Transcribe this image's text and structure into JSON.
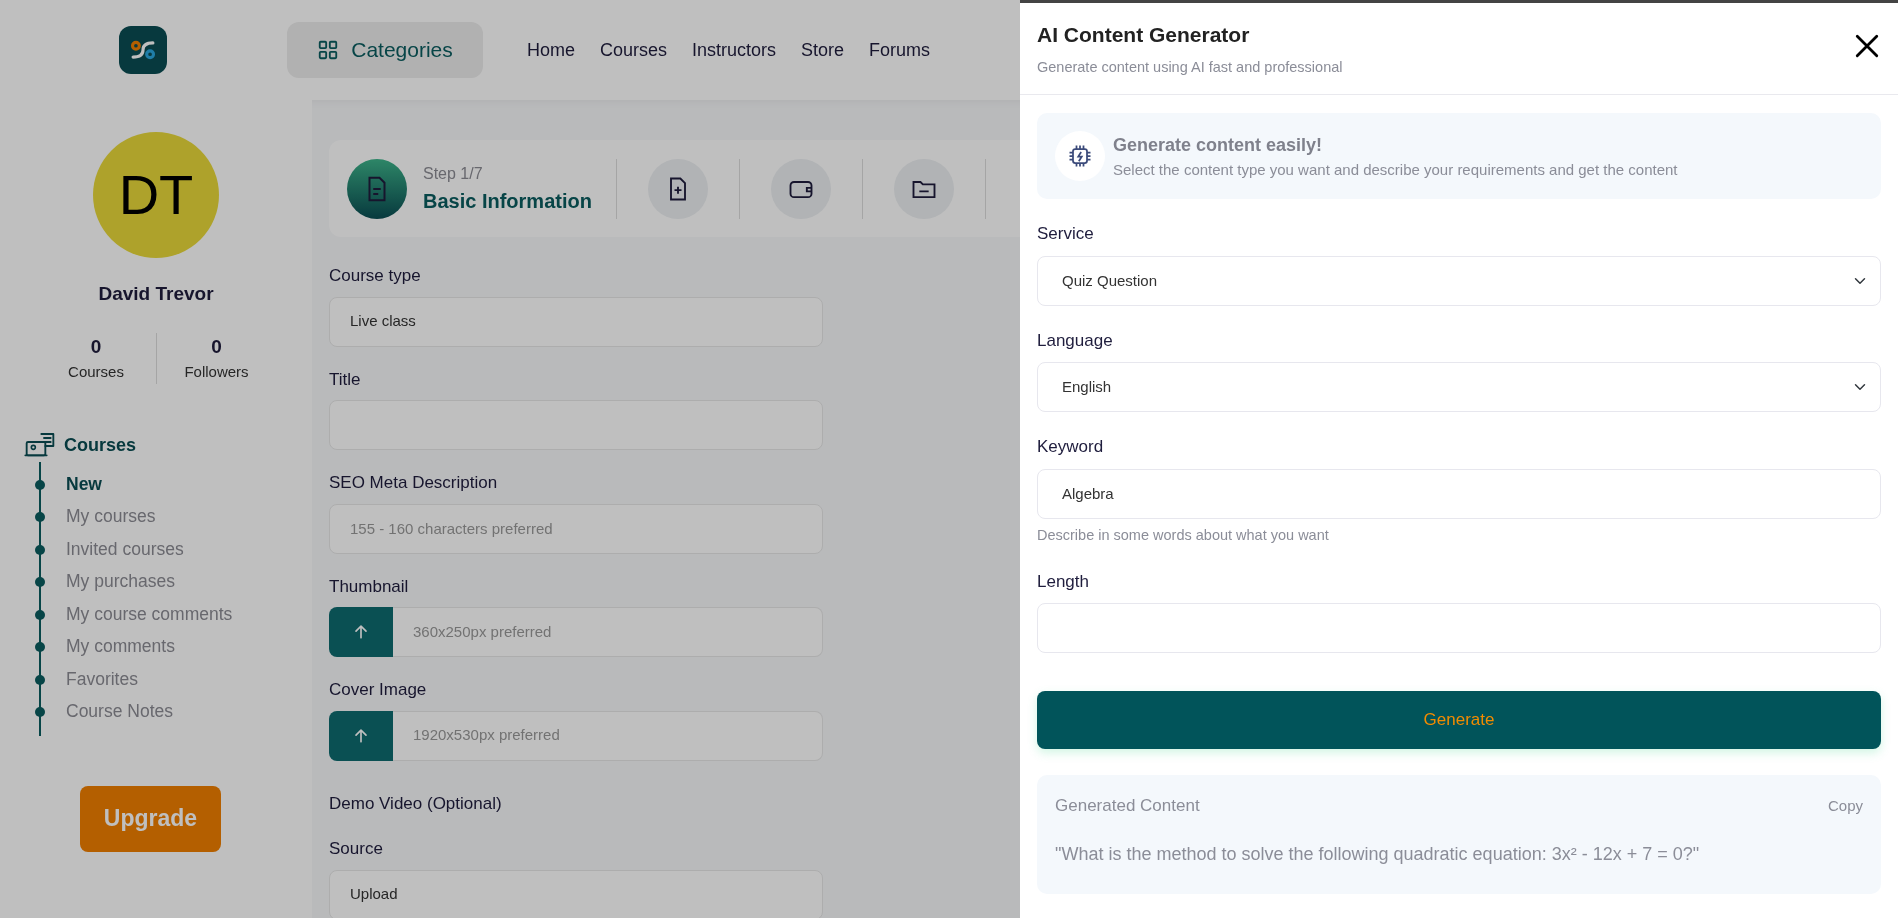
{
  "header": {
    "categories_button": "Categories",
    "nav_links": [
      "Home",
      "Courses",
      "Instructors",
      "Store",
      "Forums"
    ]
  },
  "sidebar": {
    "avatar_initials": "DT",
    "name": "David Trevor",
    "stats": [
      {
        "value": "0",
        "label": "Courses"
      },
      {
        "value": "0",
        "label": "Followers"
      }
    ],
    "menu": {
      "title": "Courses",
      "items": [
        {
          "label": "New",
          "selected": true
        },
        {
          "label": "My courses",
          "selected": false
        },
        {
          "label": "Invited courses",
          "selected": false
        },
        {
          "label": "My purchases",
          "selected": false
        },
        {
          "label": "My course comments",
          "selected": false
        },
        {
          "label": "My comments",
          "selected": false
        },
        {
          "label": "Favorites",
          "selected": false
        },
        {
          "label": "Course Notes",
          "selected": false
        }
      ]
    },
    "upgrade_button": "Upgrade"
  },
  "step_progress": {
    "step_label": "Step 1/7",
    "title": "Basic Information"
  },
  "form": [
    {
      "kind": "select",
      "label": "Course type",
      "value": "Live class"
    },
    {
      "kind": "text",
      "label": "Title"
    },
    {
      "kind": "text",
      "label": "SEO Meta Description",
      "placeholder": "155 - 160 characters preferred"
    },
    {
      "kind": "file",
      "label": "Thumbnail",
      "placeholder": "360x250px preferred"
    },
    {
      "kind": "file",
      "label": "Cover Image",
      "placeholder": "1920x530px preferred"
    },
    {
      "kind": "heading",
      "label": "Demo Video (Optional)"
    },
    {
      "kind": "select",
      "label": "Source",
      "value": "Upload"
    }
  ],
  "drawer": {
    "title": "AI Content Generator",
    "subtitle": "Generate content using AI fast and professional",
    "info": {
      "title": "Generate content easily!",
      "text": "Select the content type you want and describe your requirements and get the content"
    },
    "fields": [
      {
        "kind": "select",
        "label": "Service",
        "value": "Quiz Question"
      },
      {
        "kind": "select",
        "label": "Language",
        "value": "English"
      },
      {
        "kind": "text",
        "label": "Keyword",
        "value": "Algebra",
        "hint": "Describe in some words about what you want"
      },
      {
        "kind": "text",
        "label": "Length"
      }
    ],
    "generate_button": "Generate",
    "result": {
      "title": "Generated Content",
      "copy_button": "Copy",
      "text": "\"What is the method to solve the following quadratic equation: 3x² - 12x + 7 = 0?\""
    }
  }
}
